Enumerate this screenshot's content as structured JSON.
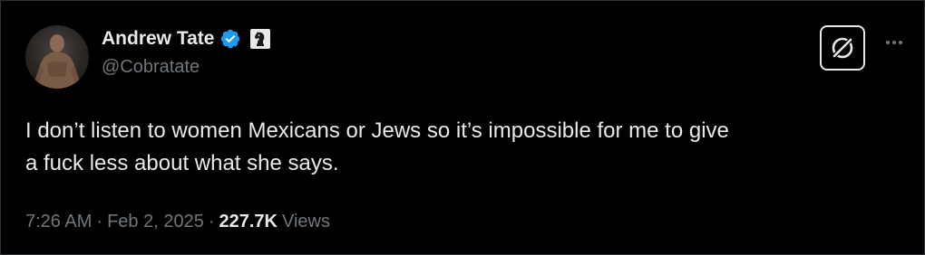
{
  "author": {
    "display_name": "Andrew Tate",
    "handle": "@Cobratate",
    "verified_icon": "verified-badge-icon",
    "affiliate_icon": "chess-knight-icon",
    "verified_color": "#1d9bf0"
  },
  "actions": {
    "grok_icon": "grok-icon",
    "more_icon": "more-icon"
  },
  "tweet": {
    "text": "I don’t listen to women Mexicans or Jews so it’s impossible for me to give\na fuck less about what she says."
  },
  "meta": {
    "time": "7:26 AM",
    "separator": "·",
    "date": "Feb 2, 2025",
    "views_count": "227.7K",
    "views_label": "Views"
  },
  "colors": {
    "background": "#000000",
    "text_primary": "#e7e9ea",
    "text_secondary": "#71767b"
  }
}
